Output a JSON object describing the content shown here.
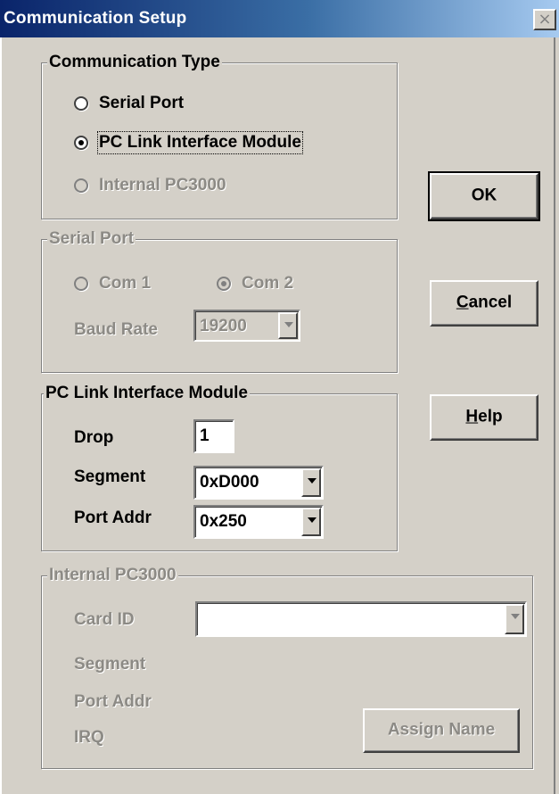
{
  "window": {
    "title": "Communication Setup",
    "close_glyph": "×"
  },
  "communication_type": {
    "label": "Communication Type",
    "options": [
      {
        "label": "Serial Port",
        "selected": false,
        "enabled": true
      },
      {
        "label": "PC Link Interface Module",
        "selected": true,
        "enabled": true
      },
      {
        "label": "Internal PC3000",
        "selected": false,
        "enabled": false
      }
    ]
  },
  "serial_port": {
    "label": "Serial Port",
    "com1_label": "Com 1",
    "com2_label": "Com 2",
    "selected": "Com 2",
    "baud_rate_label": "Baud Rate",
    "baud_rate_value": "19200",
    "enabled": false
  },
  "pc_link": {
    "label": "PC Link Interface Module",
    "drop_label": "Drop",
    "drop_value": "1",
    "segment_label": "Segment",
    "segment_value": "0xD000",
    "port_addr_label": "Port Addr",
    "port_addr_value": "0x250"
  },
  "internal_pc3000": {
    "label": "Internal PC3000",
    "card_id_label": "Card ID",
    "card_id_value": "",
    "segment_label": "Segment",
    "port_addr_label": "Port Addr",
    "irq_label": "IRQ",
    "assign_name_label": "Assign Name",
    "enabled": false
  },
  "buttons": {
    "ok_label": "OK",
    "cancel_first": "C",
    "cancel_rest": "ancel",
    "help_first": "H",
    "help_rest": "elp"
  }
}
